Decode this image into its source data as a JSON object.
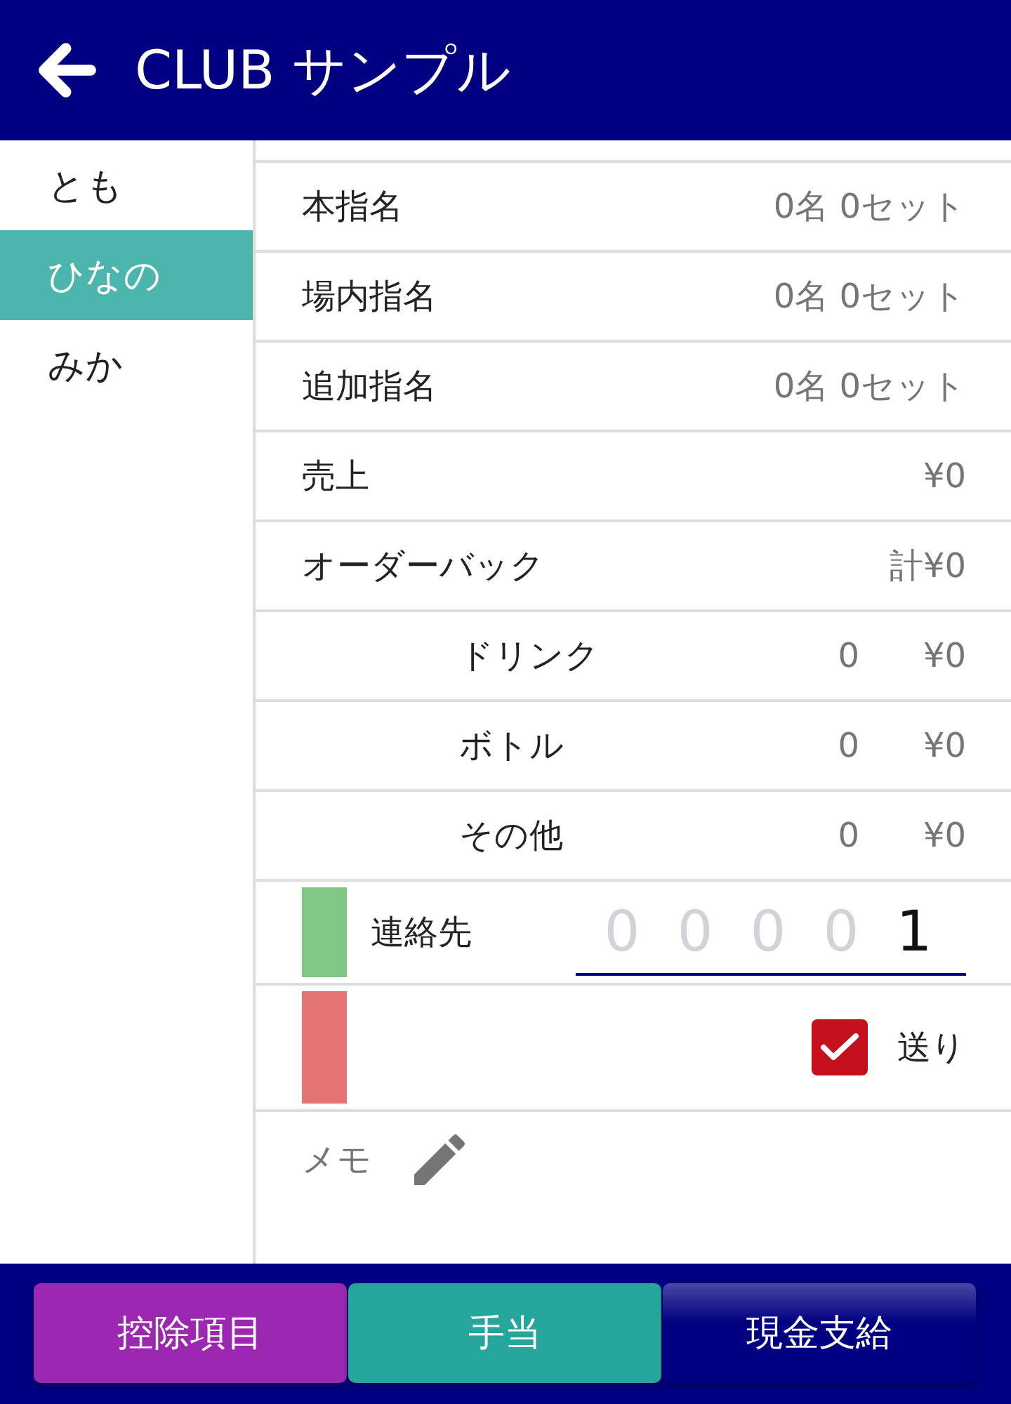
{
  "header": {
    "title": "CLUB サンプル"
  },
  "sidebar": {
    "items": [
      {
        "label": "とも",
        "selected": false
      },
      {
        "label": "ひなの",
        "selected": true
      },
      {
        "label": "みか",
        "selected": false
      }
    ]
  },
  "rows": [
    {
      "kind": "summary",
      "label": "本指名",
      "value": "0名 0セット"
    },
    {
      "kind": "summary",
      "label": "場内指名",
      "value": "0名 0セット"
    },
    {
      "kind": "summary",
      "label": "追加指名",
      "value": "0名 0セット"
    },
    {
      "kind": "summary",
      "label": "売上",
      "value": "¥0"
    },
    {
      "kind": "summary",
      "label": "オーダーバック",
      "value": "計¥0"
    },
    {
      "kind": "detail",
      "label": "ドリンク",
      "count": "0",
      "amount": "¥0"
    },
    {
      "kind": "detail",
      "label": "ボトル",
      "count": "0",
      "amount": "¥0"
    },
    {
      "kind": "detail",
      "label": "その他",
      "count": "0",
      "amount": "¥0"
    }
  ],
  "contact": {
    "label": "連絡先",
    "color": "#81c784",
    "digits": [
      {
        "digit": "0",
        "entered": false
      },
      {
        "digit": "0",
        "entered": false
      },
      {
        "digit": "0",
        "entered": false
      },
      {
        "digit": "0",
        "entered": false
      },
      {
        "digit": "1",
        "entered": true
      }
    ]
  },
  "sendoff": {
    "color": "#e57373",
    "checkbox": {
      "label": "送り",
      "checked": true
    }
  },
  "memo": {
    "label": "メモ"
  },
  "footer": {
    "buttons": [
      {
        "label": "控除項目",
        "color": "#9c27b0",
        "highlighted": false
      },
      {
        "label": "手当",
        "color": "#26a69a",
        "highlighted": false
      },
      {
        "label": "現金支給",
        "color": "#000080",
        "highlighted": true
      }
    ]
  }
}
